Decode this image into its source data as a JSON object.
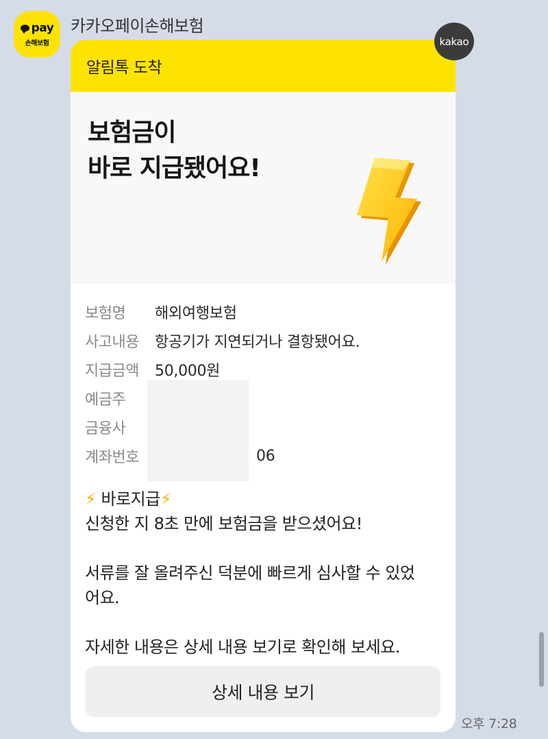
{
  "sender": {
    "name": "카카오페이손해보험",
    "avatar_text_top": "pay",
    "avatar_text_bottom": "손해보험",
    "avatar_color": "#ffe300"
  },
  "badge": {
    "label": "kakao"
  },
  "card": {
    "header": "알림톡 도착",
    "header_color": "#ffe300",
    "hero_line1": "보험금이",
    "hero_line2": "바로 지급됐어요!",
    "hero_icon": "lightning-bolt-3d-icon",
    "info": [
      {
        "label": "보험명",
        "value": "해외여행보험"
      },
      {
        "label": "사고내용",
        "value": "항공기가 지연되거나 결항됐어요."
      },
      {
        "label": "지급금액",
        "value": "50,000원"
      },
      {
        "label": "예금주",
        "value": ""
      },
      {
        "label": "금융사",
        "value": ""
      },
      {
        "label": "계좌번호",
        "value": "06"
      }
    ],
    "body": {
      "bolt_glyph": "⚡",
      "title": " 바로지급",
      "line1": "신청한 지 8초 만에 보험금을 받으셨어요!",
      "line2": "서류를 잘 올려주신 덕분에 빠르게 심사할 수 있었",
      "line3": "어요.",
      "line4": "자세한 내용은 상세 내용 보기로 확인해 보세요."
    },
    "button_label": "상세 내용 보기"
  },
  "timestamp": "오후 7:28"
}
